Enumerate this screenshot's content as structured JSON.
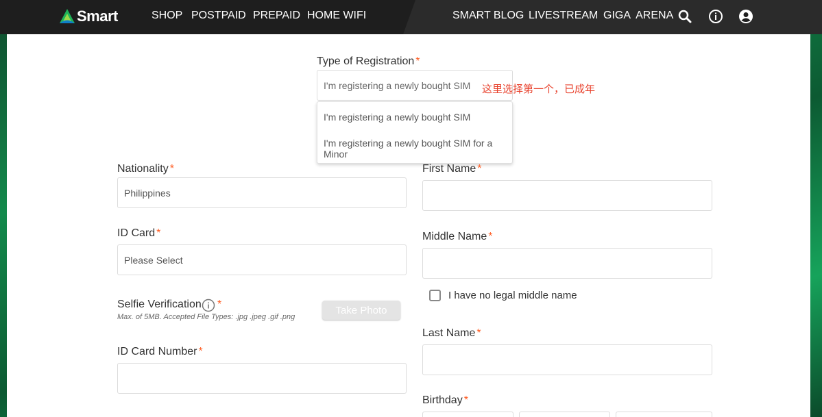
{
  "header": {
    "brand": "Smart",
    "nav_left": [
      "SHOP",
      "POSTPAID",
      "PREPAID",
      "HOME WIFI"
    ],
    "nav_right": [
      "SMART BLOG",
      "LIVESTREAM",
      "GIGA  ARENA"
    ],
    "icons": [
      "search-icon",
      "info-icon",
      "account-icon"
    ]
  },
  "form": {
    "registration_type": {
      "label": "Type of Registration",
      "value": "I'm registering a newly bought SIM",
      "options": [
        "I'm registering a newly bought SIM",
        "I'm registering a newly bought SIM for a Minor"
      ]
    },
    "annotation": "这里选择第一个，已成年",
    "required_mark": "*",
    "nationality": {
      "label": "Nationality",
      "value": "Philippines"
    },
    "id_card": {
      "label": "ID Card",
      "placeholder": "Please Select"
    },
    "selfie": {
      "label": "Selfie Verification",
      "hint": "Max. of 5MB. Accepted File Types: .jpg .jpeg .gif  .png",
      "button": "Take Photo"
    },
    "id_card_number": {
      "label": "ID Card Number",
      "value": ""
    },
    "first_name": {
      "label": "First Name",
      "value": ""
    },
    "middle_name": {
      "label": "Middle Name",
      "value": ""
    },
    "no_middle_name": {
      "label": "I have no legal middle name",
      "checked": false
    },
    "last_name": {
      "label": "Last Name",
      "value": ""
    },
    "birthday": {
      "label": "Birthday"
    }
  },
  "colors": {
    "accent": "#ff5a1f",
    "header": "#1e1e1e",
    "annotation": "#e8412c",
    "brand_green": "#16a35b"
  }
}
